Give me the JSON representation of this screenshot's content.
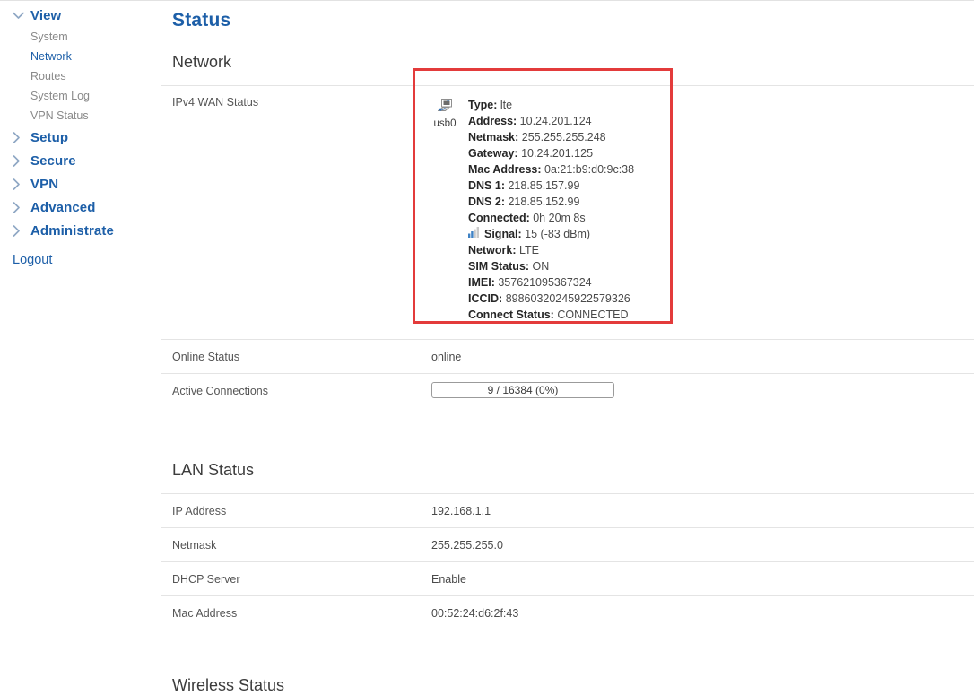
{
  "sidebar": {
    "groups": [
      {
        "label": "View",
        "expanded": true,
        "icon": "chevron-down-icon",
        "children": [
          {
            "label": "System",
            "active": false
          },
          {
            "label": "Network",
            "active": true
          },
          {
            "label": "Routes",
            "active": false
          },
          {
            "label": "System Log",
            "active": false
          },
          {
            "label": "VPN Status",
            "active": false
          }
        ]
      },
      {
        "label": "Setup",
        "expanded": false,
        "icon": "chevron-right-icon",
        "children": []
      },
      {
        "label": "Secure",
        "expanded": false,
        "icon": "chevron-right-icon",
        "children": []
      },
      {
        "label": "VPN",
        "expanded": false,
        "icon": "chevron-right-icon",
        "children": []
      },
      {
        "label": "Advanced",
        "expanded": false,
        "icon": "chevron-right-icon",
        "children": []
      },
      {
        "label": "Administrate",
        "expanded": false,
        "icon": "chevron-right-icon",
        "children": []
      }
    ],
    "logout_label": "Logout"
  },
  "main": {
    "page_title": "Status",
    "network_section": {
      "heading": "Network",
      "wan_row_label": "IPv4 WAN Status",
      "wan": {
        "interface_name": "usb0",
        "interface_icon": "network-adapter-icon",
        "signal_icon": "signal-bars-icon",
        "fields": [
          {
            "key": "Type:",
            "value": "lte"
          },
          {
            "key": "Address:",
            "value": "10.24.201.124"
          },
          {
            "key": "Netmask:",
            "value": "255.255.255.248"
          },
          {
            "key": "Gateway:",
            "value": "10.24.201.125"
          },
          {
            "key": "Mac Address:",
            "value": "0a:21:b9:d0:9c:38"
          },
          {
            "key": "DNS 1:",
            "value": "218.85.157.99"
          },
          {
            "key": "DNS 2:",
            "value": "218.85.152.99"
          },
          {
            "key": "Connected:",
            "value": "0h 20m 8s"
          },
          {
            "key": "Signal:",
            "value": "15 (-83 dBm)",
            "icon": "signal-bars-icon",
            "plain_key": true
          },
          {
            "key": "Network:",
            "value": "LTE"
          },
          {
            "key": "SIM Status:",
            "value": "ON"
          },
          {
            "key": "IMEI:",
            "value": "357621095367324"
          },
          {
            "key": "ICCID:",
            "value": "89860320245922579326"
          },
          {
            "key": "Connect Status:",
            "value": "CONNECTED"
          }
        ]
      },
      "online_status": {
        "label": "Online Status",
        "value": "online"
      },
      "active_connections": {
        "label": "Active Connections",
        "value": "9 / 16384 (0%)",
        "current": 9,
        "max": 16384,
        "percent": 0
      }
    },
    "lan_section": {
      "heading": "LAN Status",
      "rows": [
        {
          "label": "IP Address",
          "value": "192.168.1.1"
        },
        {
          "label": "Netmask",
          "value": "255.255.255.0"
        },
        {
          "label": "DHCP Server",
          "value": "Enable"
        },
        {
          "label": "Mac Address",
          "value": "00:52:24:d6:2f:43"
        }
      ]
    },
    "wireless_section": {
      "heading": "Wireless Status"
    }
  },
  "colors": {
    "brand_blue": "#1d5fa8",
    "highlight_red": "#e33b3b",
    "muted_gray": "#8a8a8a",
    "divider": "#e4e4e4"
  }
}
